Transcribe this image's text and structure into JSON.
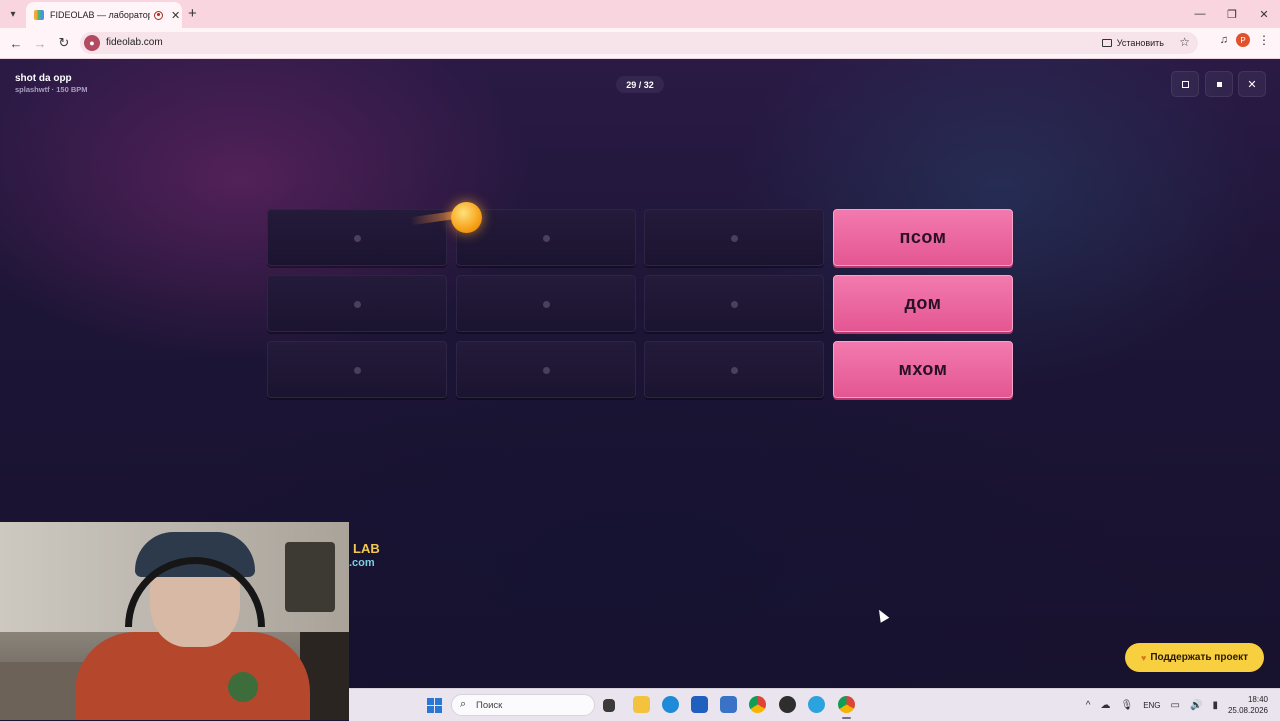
{
  "browser": {
    "tab": {
      "title": "FIDEOLAB — лаборатория"
    },
    "address": {
      "url": "fideolab.com",
      "install_label": "Установить"
    },
    "profile_initial": "P"
  },
  "player": {
    "song_title": "shot da opp",
    "song_meta": "splashwtf · 150 BPM",
    "counter": "29 / 32"
  },
  "board": {
    "rows": [
      {
        "word": "псом"
      },
      {
        "word": "дом"
      },
      {
        "word": "мхом"
      }
    ],
    "accent_color": "#ea5d9a"
  },
  "watermark": {
    "line1": "LAB",
    "line2": ".com"
  },
  "support": {
    "label": "Поддержать проект"
  },
  "taskbar": {
    "search_placeholder": "Поиск",
    "lang": "ENG",
    "time": "18:40",
    "date": "25.08.2026"
  }
}
